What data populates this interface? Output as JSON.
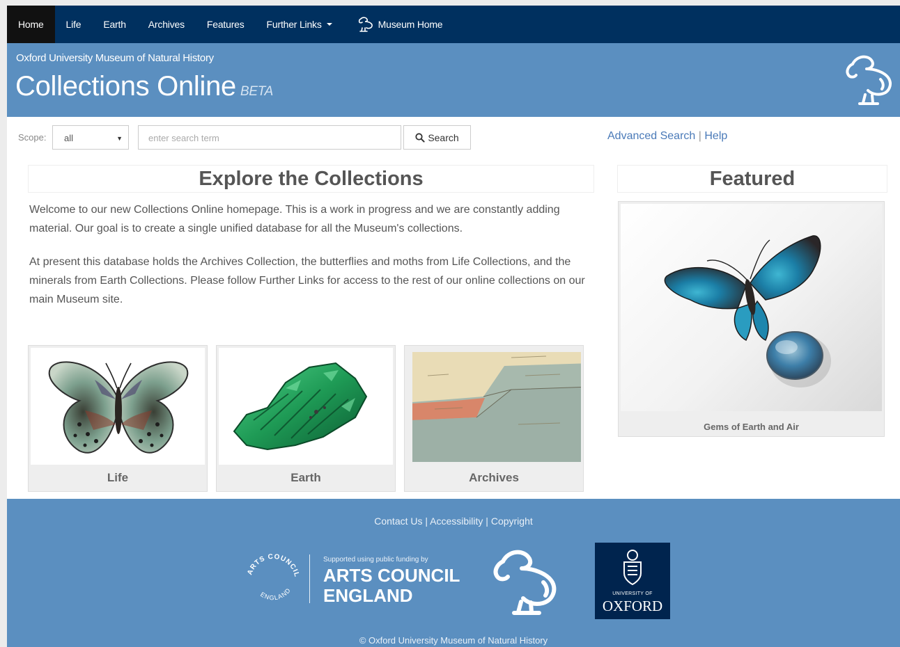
{
  "nav": {
    "items": [
      {
        "label": "Home"
      },
      {
        "label": "Life"
      },
      {
        "label": "Earth"
      },
      {
        "label": "Archives"
      },
      {
        "label": "Features"
      }
    ],
    "further_links": "Further Links",
    "museum_home": "Museum Home"
  },
  "header": {
    "subtitle": "Oxford University Museum of Natural History",
    "title": "Collections Online",
    "beta": "BETA"
  },
  "search": {
    "scope_label": "Scope:",
    "scope_value": "all",
    "placeholder": "enter search term",
    "button_label": "Search",
    "advanced_label": "Advanced Search",
    "separator": "|",
    "help_label": "Help"
  },
  "explore": {
    "heading": "Explore the Collections",
    "paragraph_1": "Welcome to our new Collections Online homepage. This is a work in progress and we are constantly adding material. Our goal is to create a single unified database for all the Museum's collections.",
    "paragraph_2": "At present this database holds the Archives Collection, the butterflies and moths from Life Collections, and the minerals from Earth Collections. Please follow Further Links for access to the rest of our online collections on our main Museum site.",
    "tiles": [
      {
        "label": "Life"
      },
      {
        "label": "Earth"
      },
      {
        "label": "Archives"
      }
    ]
  },
  "featured": {
    "heading": "Featured",
    "caption": "Gems of Earth and Air"
  },
  "footer": {
    "contact": "Contact Us",
    "accessibility": "Accessibility",
    "copyright": "Copyright",
    "separator": "|",
    "supported": "Supported using public funding by",
    "ace_line1": "ARTS COUNCIL",
    "ace_line2": "ENGLAND",
    "ace_ring_top": "ARTS COUNCIL",
    "ace_ring_bottom": "ENGLAND",
    "oxford_uni": "UNIVERSITY OF",
    "oxford_name": "OXFORD",
    "copyright_line": "© Oxford University Museum of Natural History"
  },
  "colors": {
    "nav_bg": "#00305f",
    "header_bg": "#5b8fc0",
    "link": "#4a7ab8",
    "oxford_blue": "#00244e"
  },
  "icons": {
    "search": "search-icon",
    "dodo": "dodo-icon",
    "caret": "chevron-down-icon"
  }
}
